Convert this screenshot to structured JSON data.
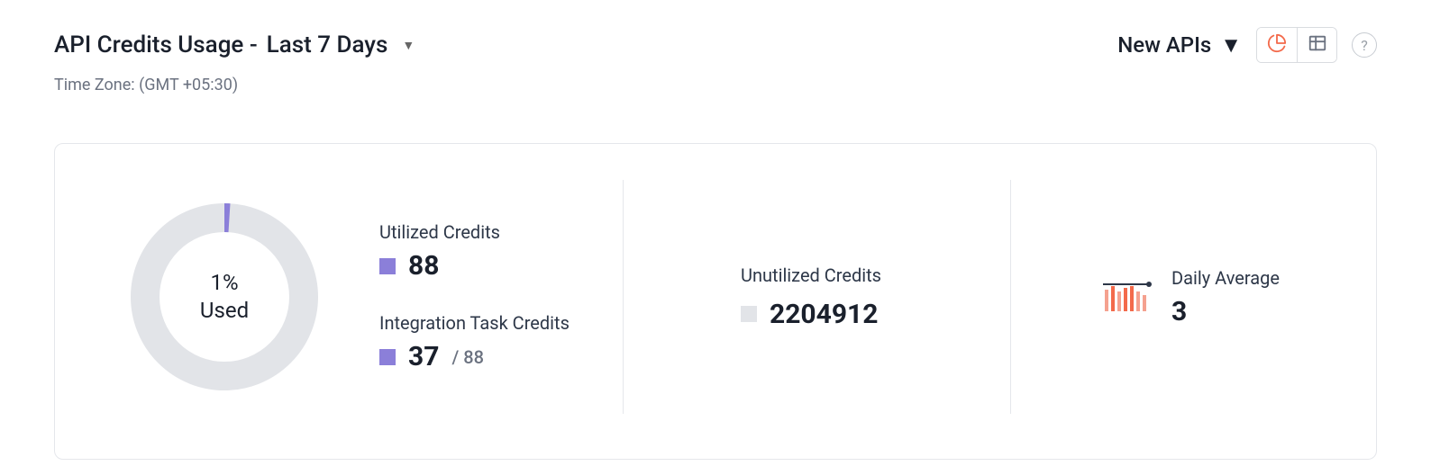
{
  "header": {
    "title_prefix": "API Credits Usage -",
    "range": "Last 7 Days",
    "timezone": "Time Zone: (GMT +05:30)",
    "new_apis_label": "New APIs"
  },
  "usage_donut": {
    "percent_used": 1,
    "center_line1": "1%",
    "center_line2": "Used"
  },
  "utilized": {
    "label": "Utilized Credits",
    "value": "88"
  },
  "integration": {
    "label": "Integration Task Credits",
    "value": "37",
    "denominator": "/ 88"
  },
  "unutilized": {
    "label": "Unutilized Credits",
    "value": "2204912"
  },
  "daily_avg": {
    "label": "Daily Average",
    "value": "3"
  },
  "colors": {
    "accent_purple": "#8b7fd9",
    "ring_bg": "#e2e4e8",
    "trend_orange": "#f36a4b"
  },
  "chart_data": {
    "type": "pie",
    "title": "API Credits Usage",
    "categories": [
      "Used",
      "Unused"
    ],
    "values": [
      1,
      99
    ],
    "series": [
      {
        "name": "Utilized Credits",
        "value": 88
      },
      {
        "name": "Integration Task Credits",
        "value": 37,
        "of": 88
      },
      {
        "name": "Unutilized Credits",
        "value": 2204912
      }
    ]
  }
}
